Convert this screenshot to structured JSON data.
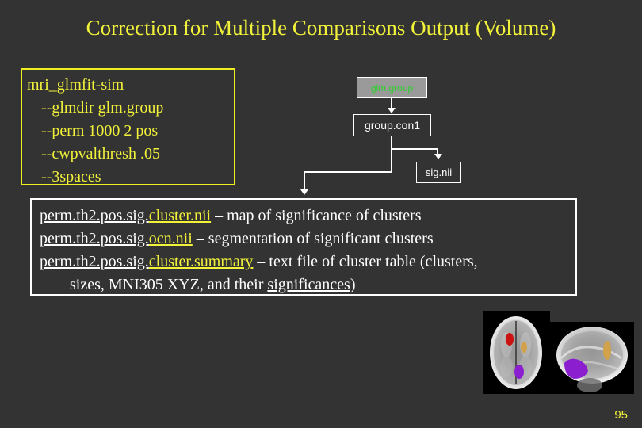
{
  "slide": {
    "title": "Correction for Multiple Comparisons Output (Volume)",
    "page_number": "95",
    "background_color": "#333333",
    "accent_color": "#F2F23A"
  },
  "command_box": {
    "border_color": "#EFEF20",
    "text_color": "#F2F23A",
    "lines": [
      {
        "text": "mri_glmfit-sim",
        "indent": false
      },
      {
        "text": "--glmdir glm.group",
        "indent": true
      },
      {
        "text": "--perm 1000 2 pos",
        "indent": true
      },
      {
        "text": "--cwpvalthresh .05",
        "indent": true
      },
      {
        "text": "--3spaces",
        "indent": true
      }
    ]
  },
  "diagram": {
    "nodes": [
      {
        "id": "glm-group",
        "label": "glm.group",
        "text_color": "#2DD02D",
        "fill_color": "#9A9A9A"
      },
      {
        "id": "group-con1",
        "label": "group.con1",
        "text_color": "#FFFFFF",
        "fill_color": "#333333"
      },
      {
        "id": "sig-nii",
        "label": "sig.nii",
        "text_color": "#FFFFFF",
        "fill_color": "#333333"
      }
    ],
    "connector_color": "#FFFFFF"
  },
  "output_box": {
    "border_color": "#FFFFFF",
    "lines": [
      {
        "prefix": "perm.th2.pos.sig.",
        "highlight": "cluster.nii",
        "suffix": " – map of significance of clusters",
        "indent": false
      },
      {
        "prefix": "perm.th2.pos.sig.",
        "highlight": "ocn.nii",
        "suffix": " – segmentation of significant clusters",
        "indent": false
      },
      {
        "prefix": "perm.th2.pos.sig.",
        "highlight": "cluster.summary",
        "suffix": " – text file of cluster table (clusters,",
        "indent": false
      },
      {
        "prefix": "",
        "highlight": "",
        "suffix": "sizes, MNI305 XYZ, and their significances)",
        "underline_word": "significances",
        "indent": true
      }
    ]
  },
  "brain_images": {
    "axial": {
      "name": "axial-brain-slice",
      "clusters": [
        "red",
        "tan",
        "purple"
      ]
    },
    "sagittal": {
      "name": "sagittal-brain-slice",
      "clusters": [
        "tan",
        "purple"
      ]
    }
  }
}
